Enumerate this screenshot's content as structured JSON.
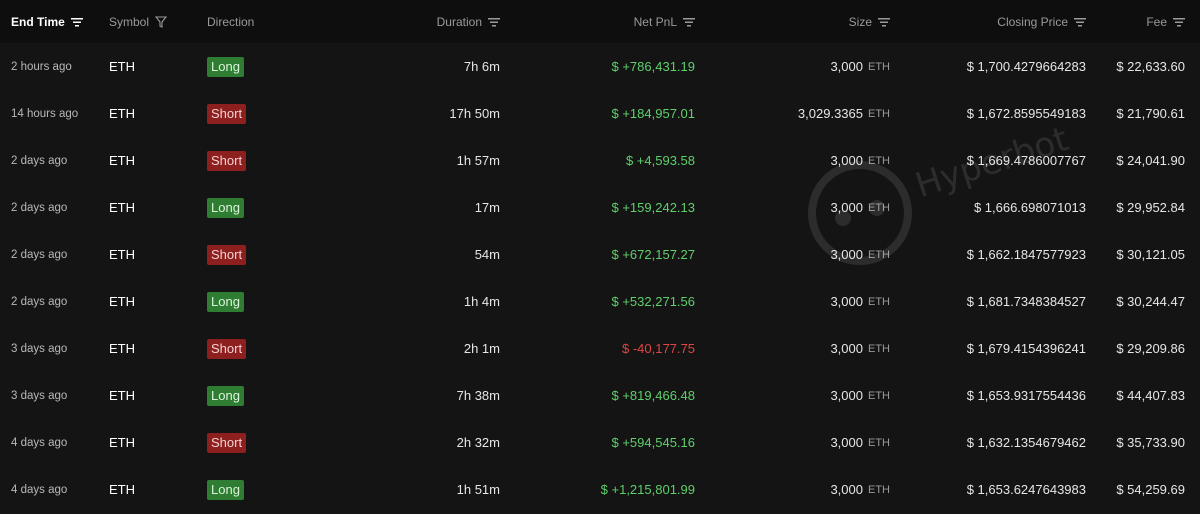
{
  "header": {
    "end_time": "End Time",
    "symbol": "Symbol",
    "direction": "Direction",
    "duration": "Duration",
    "net_pnl": "Net PnL",
    "size": "Size",
    "closing_price": "Closing Price",
    "fee": "Fee"
  },
  "watermark": "Hyperbot",
  "rows": [
    {
      "time": "2 hours ago",
      "symbol": "ETH",
      "direction": "Long",
      "duration": "7h 6m",
      "pnl": "$ +786,431.19",
      "size": "3,000",
      "unit": "ETH",
      "price": "$ 1,700.4279664283",
      "fee": "$ 22,633.60"
    },
    {
      "time": "14 hours ago",
      "symbol": "ETH",
      "direction": "Short",
      "duration": "17h 50m",
      "pnl": "$ +184,957.01",
      "size": "3,029.3365",
      "unit": "ETH",
      "price": "$ 1,672.8595549183",
      "fee": "$ 21,790.61"
    },
    {
      "time": "2 days ago",
      "symbol": "ETH",
      "direction": "Short",
      "duration": "1h 57m",
      "pnl": "$ +4,593.58",
      "size": "3,000",
      "unit": "ETH",
      "price": "$ 1,669.4786007767",
      "fee": "$ 24,041.90"
    },
    {
      "time": "2 days ago",
      "symbol": "ETH",
      "direction": "Long",
      "duration": "17m",
      "pnl": "$ +159,242.13",
      "size": "3,000",
      "unit": "ETH",
      "price": "$ 1,666.698071013",
      "fee": "$ 29,952.84"
    },
    {
      "time": "2 days ago",
      "symbol": "ETH",
      "direction": "Short",
      "duration": "54m",
      "pnl": "$ +672,157.27",
      "size": "3,000",
      "unit": "ETH",
      "price": "$ 1,662.1847577923",
      "fee": "$ 30,121.05"
    },
    {
      "time": "2 days ago",
      "symbol": "ETH",
      "direction": "Long",
      "duration": "1h 4m",
      "pnl": "$ +532,271.56",
      "size": "3,000",
      "unit": "ETH",
      "price": "$ 1,681.7348384527",
      "fee": "$ 30,244.47"
    },
    {
      "time": "3 days ago",
      "symbol": "ETH",
      "direction": "Short",
      "duration": "2h 1m",
      "pnl": "$ -40,177.75",
      "size": "3,000",
      "unit": "ETH",
      "price": "$ 1,679.4154396241",
      "fee": "$ 29,209.86"
    },
    {
      "time": "3 days ago",
      "symbol": "ETH",
      "direction": "Long",
      "duration": "7h 38m",
      "pnl": "$ +819,466.48",
      "size": "3,000",
      "unit": "ETH",
      "price": "$ 1,653.9317554436",
      "fee": "$ 44,407.83"
    },
    {
      "time": "4 days ago",
      "symbol": "ETH",
      "direction": "Short",
      "duration": "2h 32m",
      "pnl": "$ +594,545.16",
      "size": "3,000",
      "unit": "ETH",
      "price": "$ 1,632.1354679462",
      "fee": "$ 35,733.90"
    },
    {
      "time": "4 days ago",
      "symbol": "ETH",
      "direction": "Long",
      "duration": "1h 51m",
      "pnl": "$ +1,215,801.99",
      "size": "3,000",
      "unit": "ETH",
      "price": "$ 1,653.6247643983",
      "fee": "$ 54,259.69"
    }
  ],
  "colors": {
    "background": "#141414",
    "header_bg": "#0e0e0e",
    "long_badge": "#2f7d32",
    "short_badge": "#8e1f1f",
    "pnl_positive": "#5fcf6b",
    "pnl_negative": "#e04444"
  }
}
